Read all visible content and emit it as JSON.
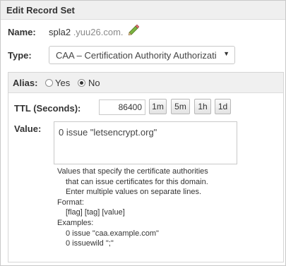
{
  "header": {
    "title": "Edit Record Set"
  },
  "name": {
    "label": "Name:",
    "value": "spla2",
    "domain": " .yuu26.com."
  },
  "type": {
    "label": "Type:",
    "selected": "CAA – Certification Authority Authorization"
  },
  "alias": {
    "label": "Alias:",
    "options": [
      {
        "label": "Yes"
      },
      {
        "label": "No"
      }
    ],
    "selected": "No"
  },
  "ttl": {
    "label": "TTL (Seconds):",
    "value": "86400",
    "buttons": [
      {
        "label": "1m"
      },
      {
        "label": "5m"
      },
      {
        "label": "1h"
      },
      {
        "label": "1d"
      }
    ]
  },
  "value": {
    "label": "Value:",
    "text": "0 issue \"letsencrypt.org\"",
    "help": [
      "Values that specify the certificate authorities",
      "that can issue certificates for this domain.",
      "Enter multiple values on separate lines.",
      "Format:",
      "[flag] [tag] [value]",
      "Examples:",
      "0 issue \"caa.example.com\"",
      "0 issuewild \";\""
    ]
  },
  "icons": {
    "edit": "pencil-icon",
    "dropdown": "chevron-down-icon"
  }
}
